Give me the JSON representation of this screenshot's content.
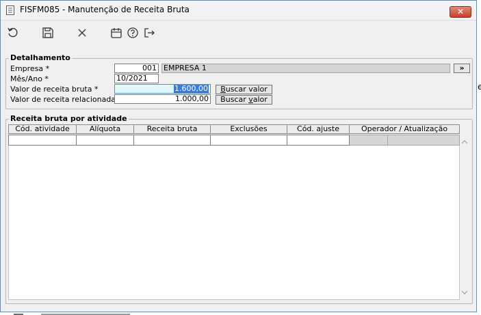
{
  "window": {
    "title": "FISFM085 - Manutenção de Receita Bruta",
    "close_symbol": "✕"
  },
  "toolbar": {
    "buttons": [
      {
        "name": "undo-icon"
      },
      {
        "name": "save-icon"
      },
      {
        "name": "close-x-icon"
      },
      {
        "name": "calendar-icon"
      },
      {
        "name": "help-icon"
      },
      {
        "name": "exit-icon"
      }
    ]
  },
  "detalhamento": {
    "legend": "Detalhamento",
    "empresa_label": "Empresa *",
    "empresa_code": "001",
    "empresa_name": "EMPRESA 1",
    "lookup_label": "»",
    "mes_ano_label": "Mês/Ano *",
    "mes_ano_value": "10/2021",
    "valor_receita_bruta_label": "Valor de receita bruta *",
    "valor_receita_bruta_value": "1.600,00",
    "valor_receita_relacionada_label": "Valor de receita relacionada",
    "valor_receita_relacionada_value": "1.000,00",
    "buscar_prefix": "B",
    "buscar_rest": "uscar valor",
    "buscar2_pre": "Buscar ",
    "buscar2_ul": "v",
    "buscar2_post": "alor"
  },
  "receita_atividade": {
    "legend": "Receita bruta por atividade",
    "columns": [
      "Cód. atividade",
      "Alíquota",
      "Receita bruta",
      "Exclusões",
      "Cód. ajuste",
      "Operador / Atualização"
    ]
  },
  "background": {
    "clipped_char": "e"
  }
}
